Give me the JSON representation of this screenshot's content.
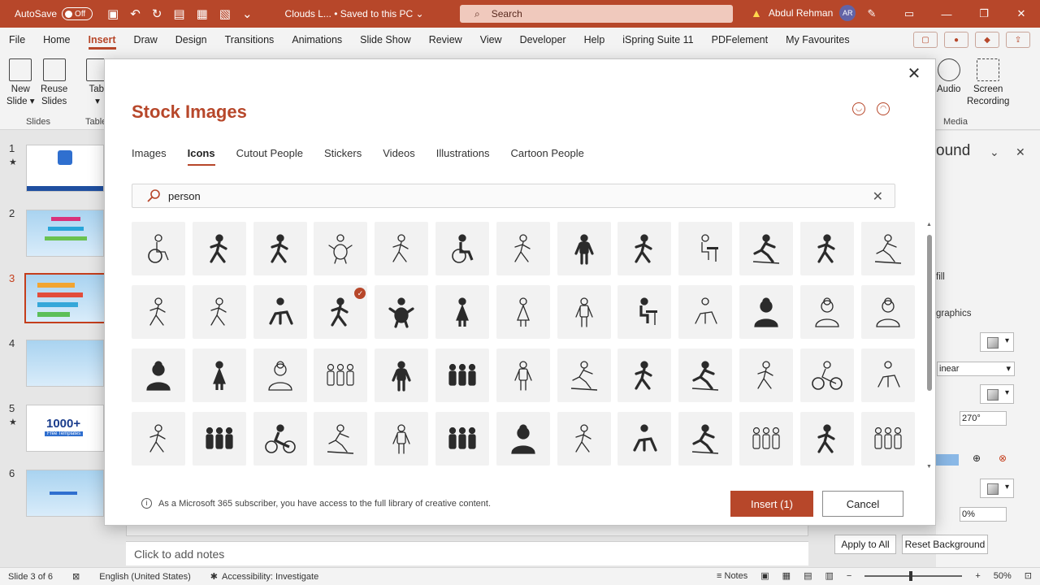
{
  "titlebar": {
    "autosave_label": "AutoSave",
    "autosave_state": "Off",
    "file_name": "Clouds L...",
    "save_status": "Saved to this PC",
    "search_placeholder": "Search",
    "user_name": "Abdul Rehman",
    "user_initials": "AR"
  },
  "ribbon_tabs": [
    "File",
    "Home",
    "Insert",
    "Draw",
    "Design",
    "Transitions",
    "Animations",
    "Slide Show",
    "Review",
    "View",
    "Developer",
    "Help",
    "iSpring Suite 11",
    "PDFelement",
    "My Favourites"
  ],
  "ribbon_active_tab": "Insert",
  "ribbon": {
    "new_slide_1": "New",
    "new_slide_2": "Slide",
    "reuse_slides_1": "Reuse",
    "reuse_slides_2": "Slides",
    "table_1": "Tabl",
    "audio": "Audio",
    "screen_rec_1": "Screen",
    "screen_rec_2": "Recording",
    "group_slides": "Slides",
    "group_table": "Table",
    "group_media": "Media"
  },
  "slides": [
    {
      "num": "1",
      "star": "★"
    },
    {
      "num": "2",
      "star": ""
    },
    {
      "num": "3",
      "star": ""
    },
    {
      "num": "4",
      "star": ""
    },
    {
      "num": "5",
      "star": "★"
    },
    {
      "num": "6",
      "star": ""
    }
  ],
  "slide5_text": "1000+",
  "slide5_sub": "Free Templates",
  "format_pane": {
    "title": "ound",
    "fill_text": "fill",
    "graphics_text": "graphics",
    "linear": "inear",
    "angle": "270°",
    "transparency": "0%",
    "apply_all": "Apply to All",
    "reset_bg": "Reset Background"
  },
  "notes_placeholder": "Click to add notes",
  "status": {
    "slide_info": "Slide 3 of 6",
    "language": "English (United States)",
    "accessibility": "Accessibility: Investigate",
    "notes": "Notes",
    "zoom": "50%"
  },
  "dialog": {
    "title": "Stock Images",
    "tabs": [
      "Images",
      "Icons",
      "Cutout People",
      "Stickers",
      "Videos",
      "Illustrations",
      "Cartoon People"
    ],
    "active_tab": "Icons",
    "search_value": "person",
    "info_text": "As a Microsoft 365 subscriber, you have access to the full library of creative content.",
    "insert_label": "Insert (1)",
    "cancel_label": "Cancel"
  },
  "icons": [
    [
      "wheelchair-outline-icon",
      "baseball-batter-icon",
      "tennis-player-icon",
      "baby-outline-icon",
      "golfer-outline-icon",
      "wheelchair-icon",
      "tennis-outline-icon",
      "person-standing-icon",
      "baseball-player-icon",
      "person-at-desk-outline-icon",
      "ice-skater-icon",
      "volleyball-player-icon",
      "skater-outline-icon"
    ],
    [
      "batter-outline-icon",
      "cricket-outline-icon",
      "sprinter-start-icon",
      "runner-selected-icon",
      "baby-icon",
      "woman-standing-icon",
      "woman-outline-icon",
      "man-outline-icon",
      "person-at-desk-icon",
      "crawling-baby-outline-icon",
      "woman-avatar-icon",
      "man-avatar-outline-icon",
      "woman-avatar-outline-icon"
    ],
    [
      "man-avatar-icon",
      "businesswoman-icon",
      "user-outline-icon",
      "group-outline-icon",
      "man-standing-icon",
      "crowd-icon",
      "person-outline-icon",
      "cross-country-skier-outline-icon",
      "dancing-couple-icon",
      "downhill-skier-icon",
      "hockey-player-outline-icon",
      "cyclist-outline-icon",
      "sprinter-outline-icon"
    ],
    [
      "dancers-outline-icon",
      "team-icon",
      "cyclist-icon",
      "skier-outline-icon",
      "businessman-outline-icon",
      "family-icon",
      "user-avatar-icon",
      "walker-outline-icon",
      "crawling-person-icon",
      "skier-icon",
      "family-outline-icon",
      "hockey-player-icon",
      "family-group-outline-icon"
    ]
  ],
  "selected_icon": "runner-selected-icon"
}
